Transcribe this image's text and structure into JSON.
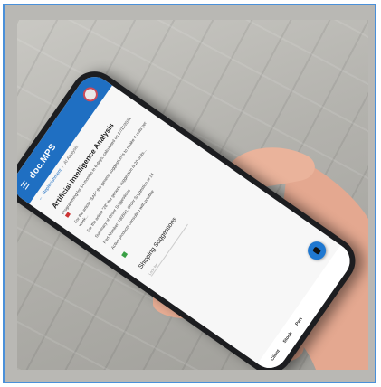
{
  "app": {
    "name": "doc.MPS"
  },
  "breadcrumb": {
    "root": "Replenishment",
    "separator": "/",
    "current": "AI Analysis"
  },
  "analysis": {
    "title": "Artificial Intelligence Analysis",
    "p1": "Programming for 14 months in 6 days, calculated on 17/11/2021",
    "p2": "For the article \"SAP\" the generic suggestion is to retake 4 units per week...",
    "p3": "For the article \"28\" the generic suggestion is 20 units...",
    "p4": "Summary of Order Suggestions",
    "p5": "Part Number: 780590, Order Suggestion of 24",
    "p6": "Active products consulted with positive"
  },
  "shipping": {
    "title": "Shipping Suggestions",
    "field_placeholder": "Look for",
    "columns": [
      "Client",
      "Stock",
      "Part"
    ]
  },
  "colors": {
    "accent": "#1f6fc2",
    "fab": "#1f78d1",
    "flag": "#cc3333",
    "status_ok": "#3aa045"
  }
}
